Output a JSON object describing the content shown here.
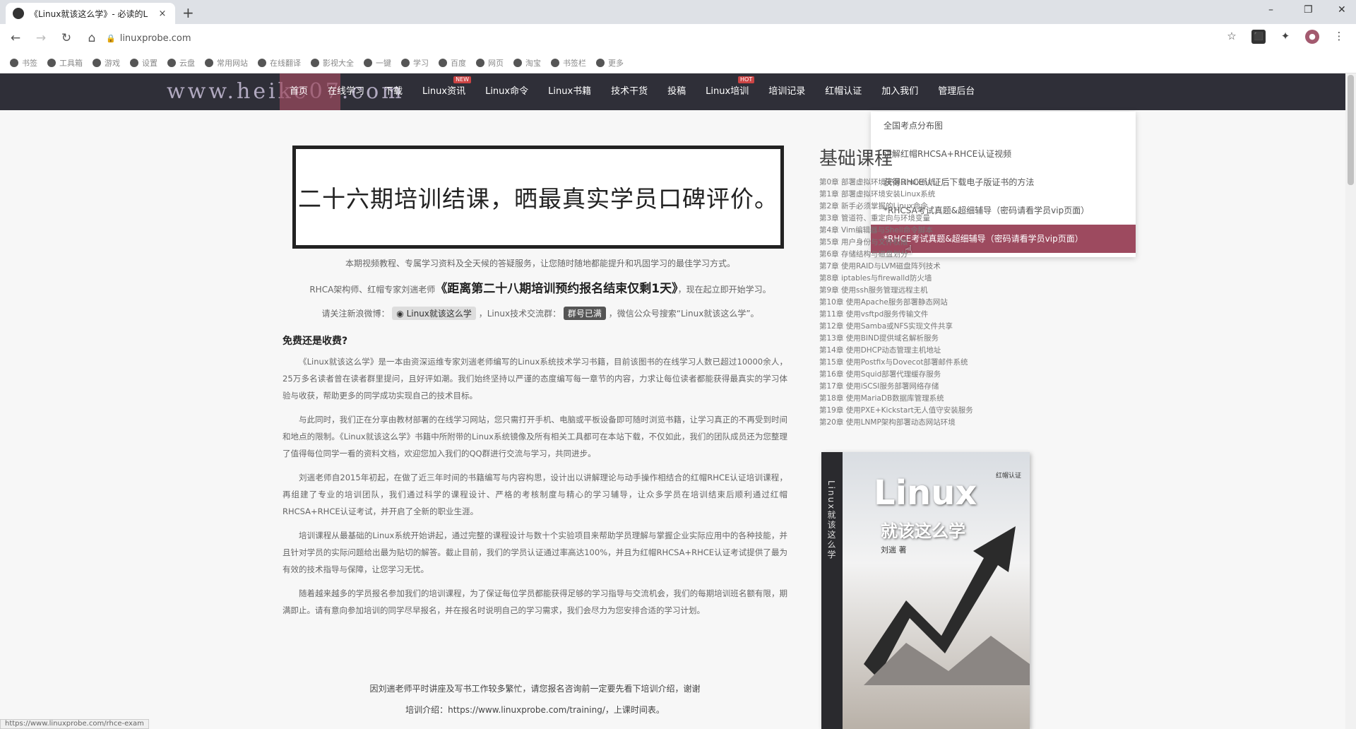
{
  "browser": {
    "tab_title": "《Linux就该这么学》- 必读的L",
    "tab_close": "×",
    "new_tab": "+",
    "url": "linuxprobe.com",
    "window_controls": [
      "–",
      "❐",
      "✕"
    ],
    "bookmarks": [
      "书签",
      "工具箱",
      "游戏",
      "设置",
      "云盘",
      "常用网站",
      "在线翻译",
      "影视大全",
      "一键",
      "学习",
      "百度",
      "网页",
      "淘宝",
      "书签栏",
      "更多"
    ]
  },
  "site_nav": {
    "logo": "www.heike07.com",
    "items": [
      {
        "label": "首页",
        "hot": ""
      },
      {
        "label": "在线学习",
        "hot": ""
      },
      {
        "label": "下载",
        "hot": ""
      },
      {
        "label": "Linux资讯",
        "hot": "NEW"
      },
      {
        "label": "Linux命令",
        "hot": ""
      },
      {
        "label": "Linux书籍",
        "hot": ""
      },
      {
        "label": "技术干货",
        "hot": ""
      },
      {
        "label": "投稿",
        "hot": ""
      },
      {
        "label": "Linux培训",
        "hot": "HOT"
      },
      {
        "label": "培训记录",
        "hot": ""
      },
      {
        "label": "红帽认证",
        "hot": ""
      },
      {
        "label": "加入我们",
        "hot": ""
      },
      {
        "label": "管理后台",
        "hot": ""
      }
    ]
  },
  "dropdown": {
    "items": [
      "全国考点分布图",
      "讲解红帽RHCSA+RHCE认证视频",
      "获得RHCE认证后下载电子版证书的方法",
      "*RHCSA考试真题&超细辅导（密码请看学员vip页面）",
      "*RHCE考试真题&超细辅导（密码请看学员vip页面）"
    ],
    "active_index": 4
  },
  "main": {
    "banner": "二十六期培训结课，晒最真实学员口碑评价。",
    "intro_line1": "本期视频教程、专属学习资料及全天候的答疑服务，让您随时随地都能提升和巩固学习的最佳学习方式。",
    "intro_line2_prefix": "RHCA架构师、红帽专家刘遄老师",
    "intro_line2_bold": "《距离第二十八期培训预约报名结束仅剩1天》",
    "intro_line2_suffix": "，现在起立即开始学习。",
    "social_prefix": "请关注新浪微博：",
    "social_weibo": "Linux就该这么学",
    "social_mid": "，Linux技术交流群：",
    "social_group": "群号已满",
    "social_suffix": "，微信公众号搜索“Linux就该这么学”。",
    "free_title": "免费还是收费?",
    "paragraphs": [
      "《Linux就该这么学》是一本由资深运维专家刘遄老师编写的Linux系统技术学习书籍，目前该图书的在线学习人数已超过10000余人，25万多名读者曾在读者群里提问，且好评如潮。我们始终坚持以严谨的态度编写每一章节的内容，力求让每位读者都能获得最真实的学习体验与收获，帮助更多的同学成功实现自己的技术目标。",
      "与此同时，我们正在分享由教材部署的在线学习网站，您只需打开手机、电脑或平板设备即可随时浏览书籍，让学习真正的不再受到时间和地点的限制。《Linux就该这么学》书籍中所附带的Linux系统镜像及所有相关工具都可在本站下载，不仅如此，我们的团队成员还为您整理了值得每位同学一看的资料文档，欢迎您加入我们的QQ群进行交流与学习，共同进步。",
      "刘遄老师自2015年初起，在做了近三年时间的书籍编写与内容构思，设计出以讲解理论与动手操作相结合的红帽RHCE认证培训课程，再组建了专业的培训团队，我们通过科学的课程设计、严格的考核制度与精心的学习辅导，让众多学员在培训结束后顺利通过红帽RHCSA+RHCE认证考试，并开启了全新的职业生涯。",
      "培训课程从最基础的Linux系统开始讲起，通过完整的课程设计与数十个实验项目来帮助学员理解与掌握企业实际应用中的各种技能，并且针对学员的实际问题给出最为贴切的解答。截止目前，我们的学员认证通过率高达100%，并且为红帽RHCSA+RHCE认证考试提供了最为有效的技术指导与保障，让您学习无忧。",
      "随着越来越多的学员报名参加我们的培训课程，为了保证每位学员都能获得足够的学习指导与交流机会，我们的每期培训班名额有限，期满即止。请有意向参加培训的同学尽早报名，并在报名时说明自己的学习需求，我们会尽力为您安排合适的学习计划。"
    ],
    "tail_line1": "因刘遄老师平时讲座及写书工作较多繁忙，请您报名咨询前一定要先看下培训介绍，谢谢",
    "tail_line2": "培训介绍：https://www.linuxprobe.com/training/，上课时间表。"
  },
  "sidebar": {
    "title": "基础课程",
    "chapters": [
      "第0章 部署虚拟环境安装Linux系统",
      "第1章 部署虚拟环境安装Linux系统",
      "第2章 新手必须掌握的Linux命令",
      "第3章 管道符、重定向与环境变量",
      "第4章 Vim编辑器与Shell命令脚本",
      "第5章 用户身份与文件权限",
      "第6章 存储结构与磁盘划分",
      "第7章 使用RAID与LVM磁盘阵列技术",
      "第8章 iptables与firewalld防火墙",
      "第9章 使用ssh服务管理远程主机",
      "第10章 使用Apache服务部署静态网站",
      "第11章 使用vsftpd服务传输文件",
      "第12章 使用Samba或NFS实现文件共享",
      "第13章 使用BIND提供域名解析服务",
      "第14章 使用DHCP动态管理主机地址",
      "第15章 使用Postfix与Dovecot部署邮件系统",
      "第16章 使用Squid部署代理缓存服务",
      "第17章 使用iSCSI服务部署网络存储",
      "第18章 使用MariaDB数据库管理系统",
      "第19章 使用PXE+Kickstart无人值守安装服务",
      "第20章 使用LNMP架构部署动态网站环境"
    ],
    "book_spine": "Linux就该这么学",
    "book_title": "Linux",
    "book_subtitle": "就该这么学",
    "book_author": "刘遄 著",
    "book_series": "红帽认证"
  },
  "status_url": "https://www.linuxprobe.com/rhce-exam"
}
